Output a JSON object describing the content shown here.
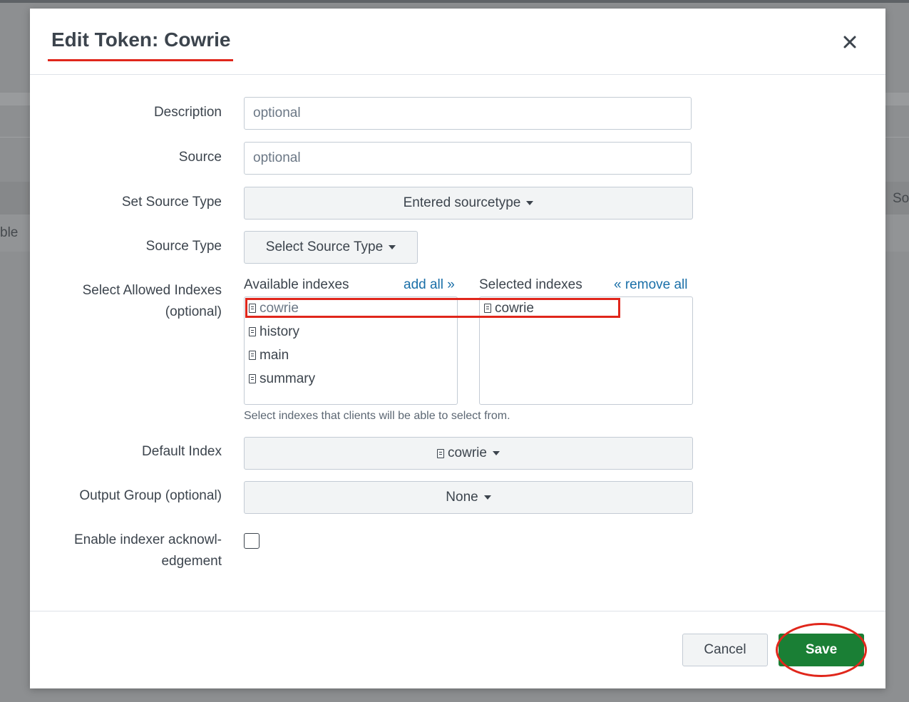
{
  "background": {
    "left_text": "ble",
    "right_text": "So"
  },
  "modal": {
    "title": "Edit Token: Cowrie",
    "annotation_color": "#e0261b"
  },
  "fields": {
    "description": {
      "label": "Description",
      "placeholder": "optional"
    },
    "source": {
      "label": "Source",
      "placeholder": "optional"
    },
    "set_source_type": {
      "label": "Set Source Type",
      "value": "Entered sourcetype"
    },
    "source_type": {
      "label": "Source Type",
      "value": "Select Source Type"
    },
    "allowed_indexes": {
      "label_line1": "Select Allowed Indexes",
      "label_line2": "(optional)",
      "available_header": "Available indexes",
      "add_all": "add all »",
      "selected_header": "Selected indexes",
      "remove_all": "« remove all",
      "available": [
        "cowrie",
        "history",
        "main",
        "summary"
      ],
      "selected": [
        "cowrie"
      ],
      "help": "Select indexes that clients will be able to select from."
    },
    "default_index": {
      "label": "Default Index",
      "value": "cowrie",
      "icon": "index-icon"
    },
    "output_group": {
      "label": "Output Group (optional)",
      "value": "None"
    },
    "indexer_ack": {
      "label_line1": "Enable indexer acknowl-",
      "label_line2": "edgement",
      "checked": false
    }
  },
  "footer": {
    "cancel_label": "Cancel",
    "save_label": "Save",
    "save_color": "#1a7f35"
  }
}
